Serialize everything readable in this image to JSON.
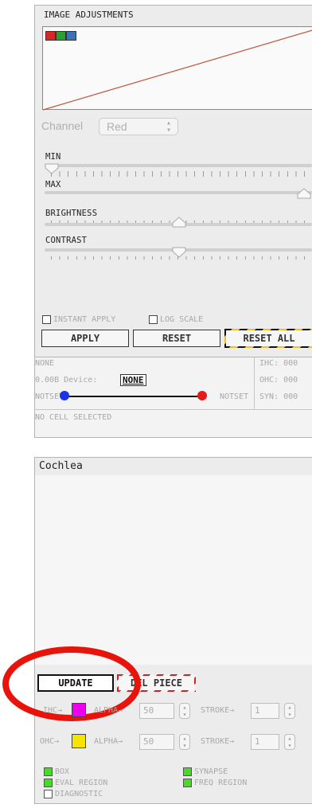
{
  "image_adjustments": {
    "title": "IMAGE ADJUSTMENTS",
    "channel_label": "Channel",
    "channel_value": "Red",
    "sliders": [
      {
        "label": "MIN",
        "value": 0.0
      },
      {
        "label": "MAX",
        "value": 0.95
      },
      {
        "label": "BRIGHTNESS",
        "value": 0.5
      },
      {
        "label": "CONTRAST",
        "value": 0.5
      }
    ],
    "instant_apply_label": "INSTANT APPLY",
    "log_scale_label": "LOG SCALE",
    "apply_label": "APPLY",
    "reset_label": "RESET",
    "reset_all_label": "RESET ALL",
    "colors": {
      "red": "#d62828",
      "green": "#2ca02c",
      "blue": "#3f72b5",
      "curve": "#c0533a"
    }
  },
  "info": {
    "none_text": "NONE",
    "device_text": "0.00B Device:",
    "device_value": "NONE",
    "notset_left": "NOTSET",
    "notset_right": "NOTSET",
    "ihc_text": "IHC: 000",
    "ohc_text": "OHC: 000",
    "syn_text": "SYN: 000",
    "no_cell_text": "NO CELL SELECTED"
  },
  "cochlea": {
    "title": "Cochlea",
    "update_label": "UPDATE",
    "del_piece_label": "DEL PIECE",
    "ihc_label": "IHC→",
    "ohc_label": "OHC→",
    "alpha_label": "ALPHA→",
    "stroke_label": "STROKE→",
    "ihc_alpha": "50",
    "ihc_stroke": "1",
    "ohc_alpha": "50",
    "ohc_stroke": "1",
    "ihc_color": "#ee00ee",
    "ohc_color": "#f5e400"
  },
  "legend": {
    "box_label": "BOX",
    "synapse_label": "SYNAPSE",
    "eval_region_label": "EVAL REGION",
    "freq_region_label": "FREQ REGION",
    "diagnostic_label": "DIAGNOSTIC",
    "green_color": "#44dd22"
  }
}
